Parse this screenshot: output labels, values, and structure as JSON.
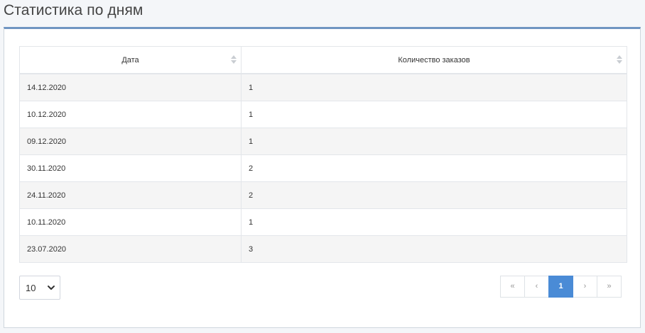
{
  "page": {
    "title": "Статистика по дням"
  },
  "table": {
    "headers": [
      "Дата",
      "Количество заказов"
    ],
    "rows": [
      [
        "14.12.2020",
        "1"
      ],
      [
        "10.12.2020",
        "1"
      ],
      [
        "09.12.2020",
        "1"
      ],
      [
        "30.11.2020",
        "2"
      ],
      [
        "24.11.2020",
        "2"
      ],
      [
        "10.11.2020",
        "1"
      ],
      [
        "23.07.2020",
        "3"
      ]
    ]
  },
  "page_size": {
    "value": "10"
  },
  "pagination": {
    "first": "«",
    "prev": "‹",
    "current": "1",
    "next": "›",
    "last": "»"
  },
  "icons": {
    "sort": "sort-icon",
    "dropdown": "chevron-down-icon"
  },
  "colors": {
    "accent": "#4a8bd6",
    "card_top_border": "#6f95c2",
    "striped_row": "#f5f5f5"
  }
}
